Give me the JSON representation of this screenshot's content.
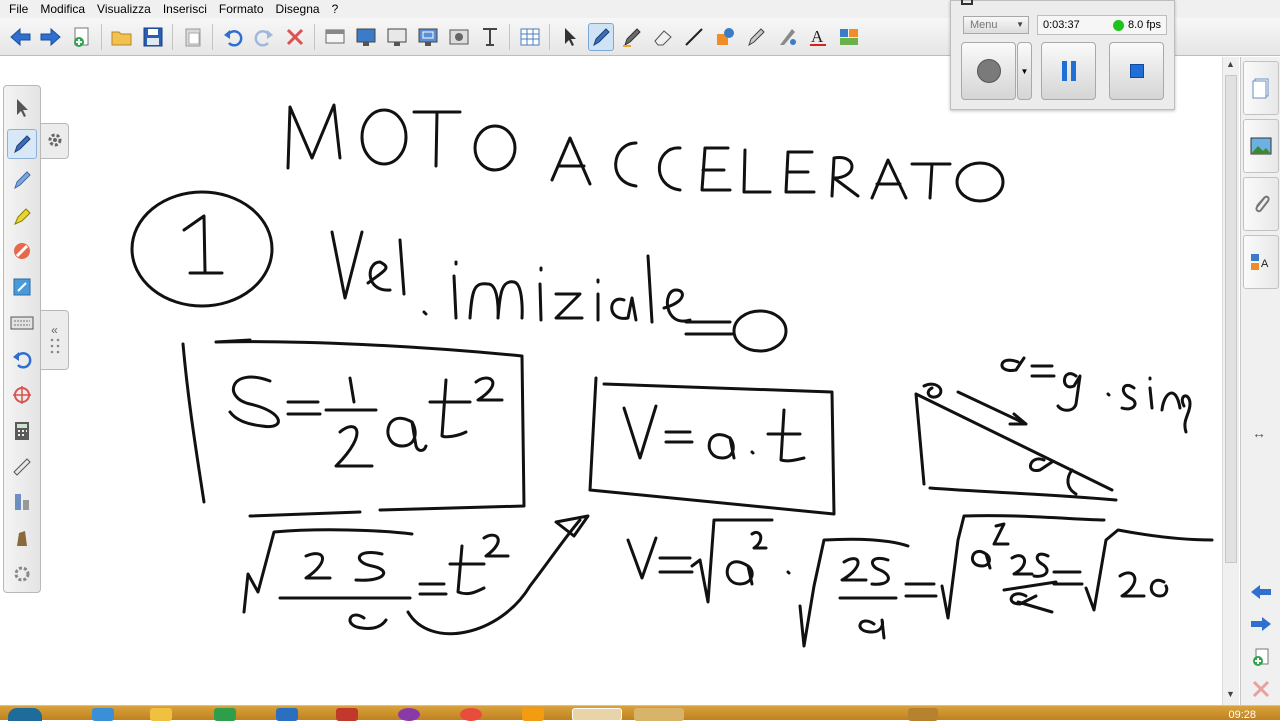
{
  "menu": [
    "File",
    "Modifica",
    "Visualizza",
    "Inserisci",
    "Formato",
    "Disegna",
    "?"
  ],
  "toolbar": {
    "icons": [
      "back-icon",
      "forward-icon",
      "new-page-icon",
      "open-folder-icon",
      "save-icon",
      "paste-icon",
      "undo-icon",
      "redo-icon",
      "delete-icon",
      "screen-shade-icon",
      "display-icon",
      "monitor-icon",
      "screen-capture-icon",
      "camera-icon",
      "text-cursor-icon",
      "table-icon",
      "select-pointer-icon",
      "pen-icon",
      "creative-pen-icon",
      "eraser-icon",
      "line-icon",
      "shapes-icon",
      "magic-pen-icon",
      "fill-icon",
      "text-icon",
      "properties-icon"
    ]
  },
  "recorder": {
    "menu_label": "Menu",
    "elapsed": "0:03:37",
    "fps": "8.0 fps",
    "status_color": "#1fc21f"
  },
  "palette": {
    "icons": [
      "select-pointer-icon",
      "pen-icon",
      "creative-pen-icon",
      "highlighter-icon",
      "eraser-icon",
      "notepad-icon",
      "keyboard-icon",
      "undo-icon",
      "crosshair-icon",
      "calculator-icon",
      "ruler-icon",
      "measure-icon",
      "shade-icon",
      "settings-icon"
    ],
    "side_icons": [
      "gear-icon",
      "collapse-icon",
      "grip-icon"
    ]
  },
  "sidebar": {
    "tabs": [
      "page-sorter-icon",
      "gallery-icon",
      "attachments-icon",
      "properties-icon"
    ],
    "nav": [
      "previous-page-icon",
      "next-page-icon",
      "add-page-icon",
      "delete-page-icon"
    ]
  },
  "board": {
    "title": "MOTO ACCELERATO",
    "number": "1",
    "initial_velocity": "Vel. iniziale = 0",
    "formula_space": "S = ½ a t²",
    "formula_velocity": "V = a · t",
    "incline_formula": "a = g · sin α",
    "incline_angle": "α",
    "derivation_time": "√(2S / a) = t",
    "derivation_velocity": "V = √(a² · 2S/a) = √(a · 2S/a) = √2a"
  },
  "taskbar": {
    "clock": "09:28"
  }
}
